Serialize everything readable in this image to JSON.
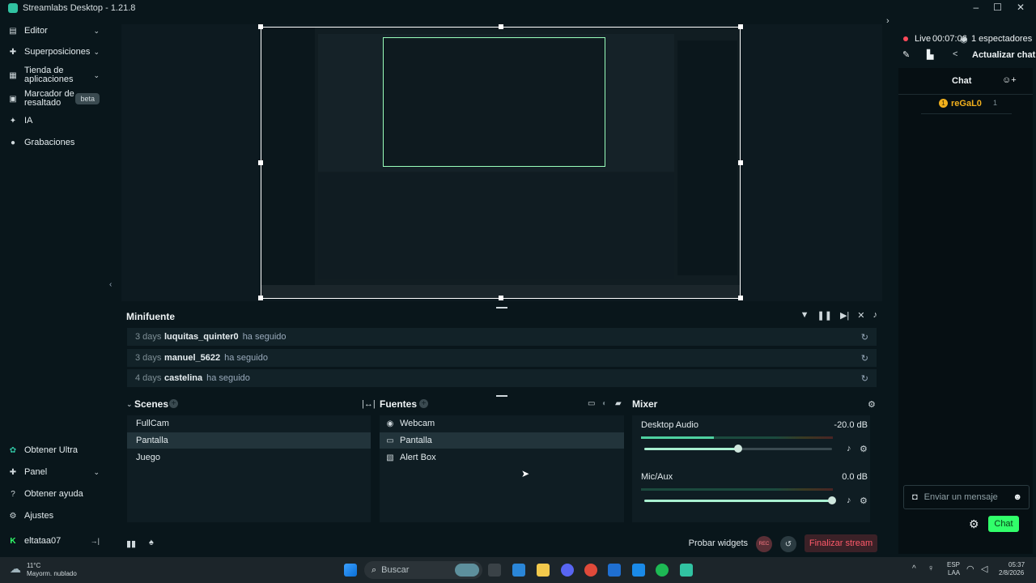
{
  "window": {
    "title": "Streamlabs Desktop - 1.21.8",
    "controls": [
      "–",
      "☐",
      "✕"
    ]
  },
  "sidebar": {
    "items": [
      {
        "label": "Editor",
        "icon": "editor-icon",
        "chevron": true
      },
      {
        "label": "Superposiciones",
        "icon": "overlays-icon",
        "chevron": true
      },
      {
        "label": "Tienda de aplicaciones",
        "icon": "app-store-icon",
        "chevron": true
      },
      {
        "label": "Marcador de resaltado",
        "icon": "highlighter-icon",
        "badge": "beta"
      },
      {
        "label": "IA",
        "icon": "ai-icon"
      },
      {
        "label": "Grabaciones",
        "icon": "recordings-icon"
      }
    ],
    "bottom_items": [
      {
        "label": "Obtener Ultra",
        "icon": "ultra-icon"
      },
      {
        "label": "Panel",
        "icon": "panel-icon",
        "chevron": true
      },
      {
        "label": "Obtener ayuda",
        "icon": "help-icon"
      },
      {
        "label": "Ajustes",
        "icon": "settings-icon"
      }
    ],
    "user": {
      "name": "eltataa07",
      "icon": "kick-icon"
    }
  },
  "minifeed": {
    "title": "Minifuente",
    "events": [
      {
        "ago": "3 days",
        "user": "luquitas_quinter0",
        "action": "ha seguido"
      },
      {
        "ago": "3 days",
        "user": "manuel_5622",
        "action": "ha seguido"
      },
      {
        "ago": "4 days",
        "user": "castelina",
        "action": "ha seguido"
      }
    ]
  },
  "scenes": {
    "title": "Scenes",
    "items": [
      "FullCam",
      "Pantalla",
      "Juego"
    ],
    "selected": "Pantalla"
  },
  "sources": {
    "title": "Fuentes",
    "items": [
      {
        "label": "Webcam",
        "icon": "webcam-icon"
      },
      {
        "label": "Pantalla",
        "icon": "monitor-icon"
      },
      {
        "label": "Alert Box",
        "icon": "alert-box-icon"
      }
    ],
    "selected": "Pantalla"
  },
  "mixer": {
    "title": "Mixer",
    "channels": [
      {
        "name": "Desktop Audio",
        "db": "-20.0 dB",
        "meter_level": 0.38,
        "volume": 0.5
      },
      {
        "name": "Mic/Aux",
        "db": "0.0 dB",
        "meter_level": 0.0,
        "volume": 1.0
      }
    ]
  },
  "footer": {
    "test_widgets": "Probar widgets",
    "rec_label": "REC",
    "end_stream": "Finalizar stream"
  },
  "right_panel": {
    "live_status": "Live",
    "live_time": "00:07:06",
    "viewers": "1 espectadores",
    "refresh_chat": "Actualizar chat",
    "chat_title": "Chat",
    "chat_user": "reGaL0",
    "chat_badge_count": "1",
    "chat_placeholder": "Enviar un mensaje",
    "chat_button": "Chat"
  },
  "taskbar": {
    "weather_temp": "11°C",
    "weather_desc": "Mayorm. nublado",
    "search_placeholder": "Buscar",
    "lang_1": "ESP",
    "lang_2": "LAA",
    "time": "05:37",
    "date": "2/8/2026"
  },
  "colors": {
    "accent": "#31c3a2",
    "live": "#ff4a5a",
    "chat_button": "#31ff6a",
    "end_stream": "#ff5a6a"
  }
}
